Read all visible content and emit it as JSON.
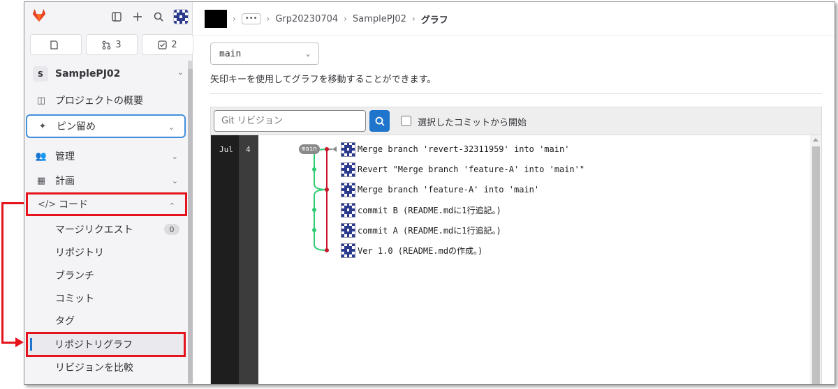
{
  "sidebar": {
    "counters": [
      {
        "icon": "issues-icon",
        "value": ""
      },
      {
        "icon": "merge-request-icon",
        "value": "3"
      },
      {
        "icon": "todo-icon",
        "value": "2"
      }
    ],
    "project": {
      "badge": "S",
      "name": "SamplePJ02"
    },
    "nav": {
      "overview": "プロジェクトの概要",
      "pinned": "ピン留め",
      "manage": "管理",
      "plan": "計画",
      "code": "コード"
    },
    "code_items": [
      {
        "label": "マージリクエスト",
        "badge": "0"
      },
      {
        "label": "リポジトリ"
      },
      {
        "label": "ブランチ"
      },
      {
        "label": "コミット"
      },
      {
        "label": "タグ"
      },
      {
        "label": "リポジトリグラフ"
      },
      {
        "label": "リビジョンを比較"
      }
    ]
  },
  "breadcrumb": {
    "dots": "•••",
    "group": "Grp20230704",
    "project": "SamplePJ02",
    "current": "グラフ"
  },
  "branch_selector": {
    "value": "main"
  },
  "hint_text": "矢印キーを使用してグラフを移動することができます。",
  "toolbar": {
    "search_placeholder": "Git リビジョン",
    "checkbox_label": "選択したコミットから開始"
  },
  "graph": {
    "month": "Jul",
    "day": "4",
    "head_label": "main",
    "commits": [
      {
        "message": "Merge branch 'revert-32311959' into 'main'"
      },
      {
        "message": "Revert \"Merge branch 'feature-A' into 'main'\""
      },
      {
        "message": "Merge branch 'feature-A' into 'main'"
      },
      {
        "message": "commit B (README.mdに1行追記。)"
      },
      {
        "message": "commit A (README.mdに1行追記。)"
      },
      {
        "message": "Ver 1.0 (README.mdの作成。)"
      }
    ],
    "colors": {
      "main_line": "#c9162b",
      "branch_line": "#2ecc71"
    }
  },
  "colors": {
    "accent": "#1f75cb",
    "highlight_red": "#e5131b"
  }
}
